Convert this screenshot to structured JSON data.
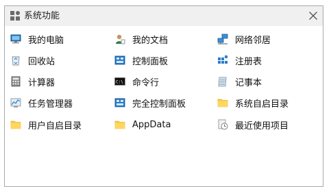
{
  "window": {
    "title": "系统功能"
  },
  "items": [
    {
      "label": "我的电脑",
      "icon": "monitor-icon"
    },
    {
      "label": "我的文档",
      "icon": "user-document-icon"
    },
    {
      "label": "网络邻居",
      "icon": "network-icon"
    },
    {
      "label": "回收站",
      "icon": "recycle-bin-icon"
    },
    {
      "label": "控制面板",
      "icon": "control-panel-icon"
    },
    {
      "label": "注册表",
      "icon": "registry-icon"
    },
    {
      "label": "计算器",
      "icon": "calculator-icon"
    },
    {
      "label": "命令行",
      "icon": "command-prompt-icon"
    },
    {
      "label": "记事本",
      "icon": "notepad-icon"
    },
    {
      "label": "任务管理器",
      "icon": "task-manager-icon"
    },
    {
      "label": "完全控制面板",
      "icon": "control-panel-icon"
    },
    {
      "label": "系统自启目录",
      "icon": "folder-icon"
    },
    {
      "label": "用户自启目录",
      "icon": "folder-icon"
    },
    {
      "label": "AppData",
      "icon": "folder-icon"
    },
    {
      "label": "最近使用项目",
      "icon": "recent-items-icon"
    }
  ]
}
